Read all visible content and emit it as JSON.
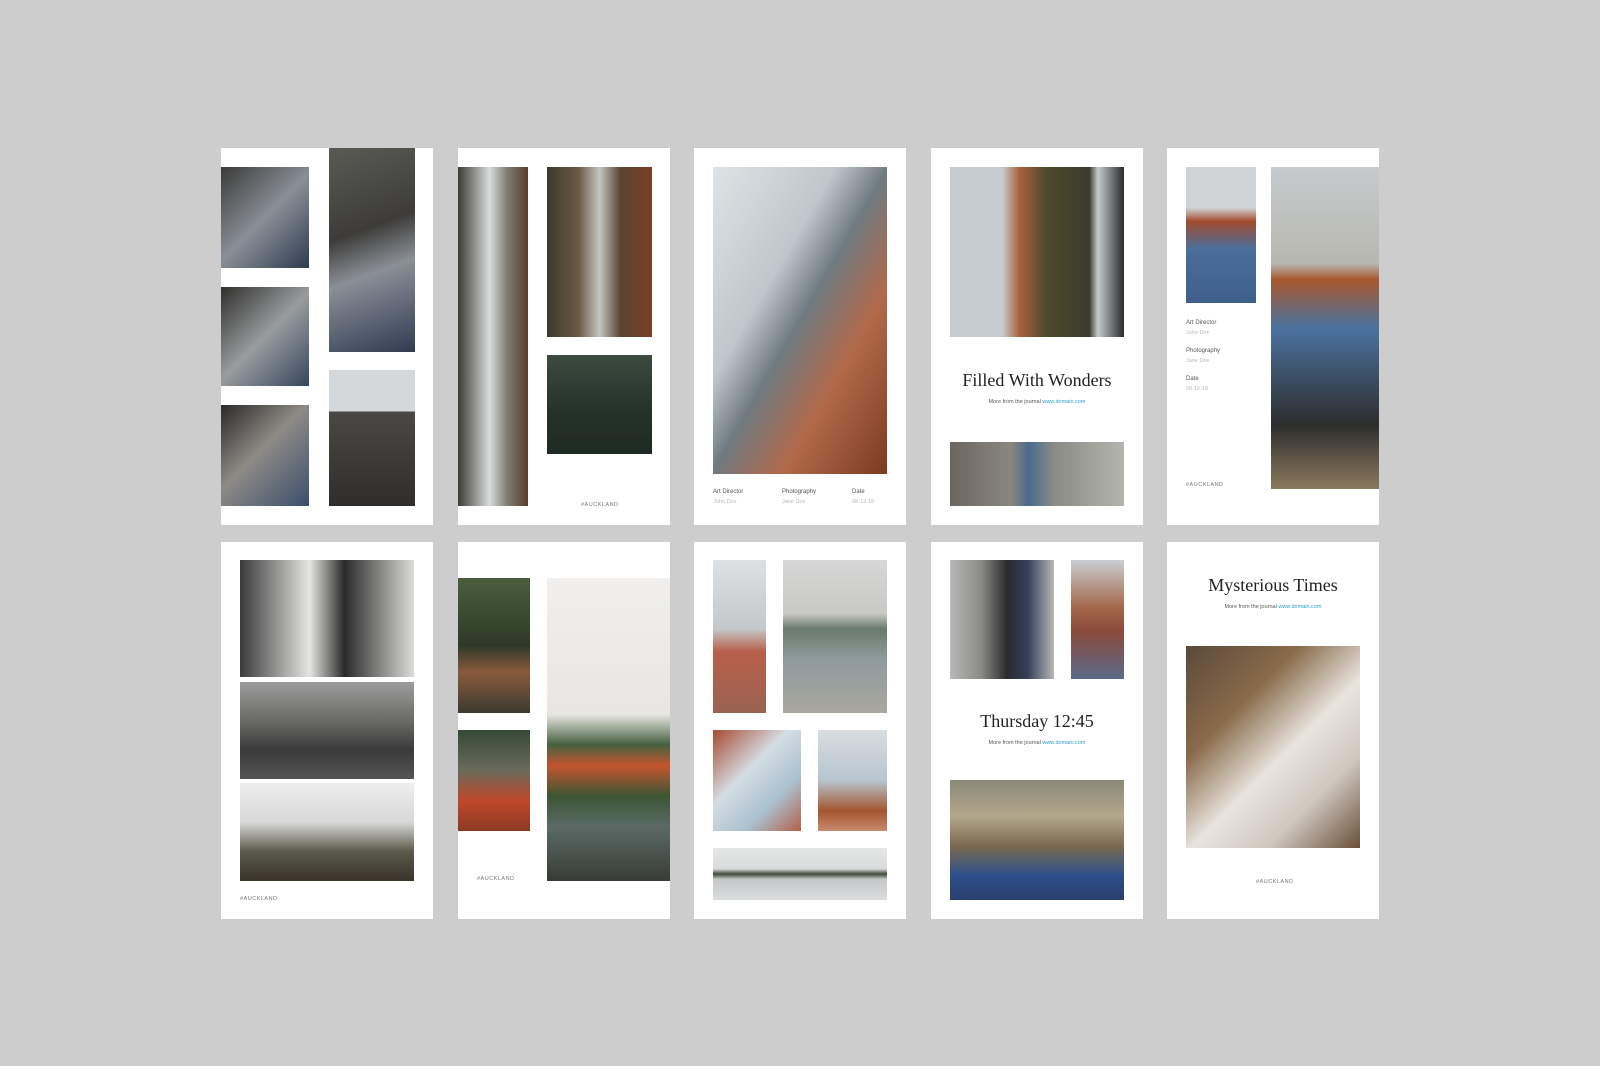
{
  "credits": {
    "art_director_label": "Art Director",
    "art_director_value": "John Doe",
    "photography_label": "Photography",
    "photography_value": "Jane Doe",
    "date_label": "Date",
    "date_value": "08-12-18"
  },
  "tag": "#AUCKLAND",
  "journal": {
    "prefix": "More from the journal",
    "link": "www.domain.com"
  },
  "cards": {
    "card4": {
      "title": "Filled With Wonders"
    },
    "card9": {
      "title": "Thursday 12:45"
    },
    "card10": {
      "title": "Mysterious Times"
    }
  },
  "colors": {
    "background": "#cdcdcd",
    "card": "#ffffff",
    "link": "#2a9fc9"
  }
}
